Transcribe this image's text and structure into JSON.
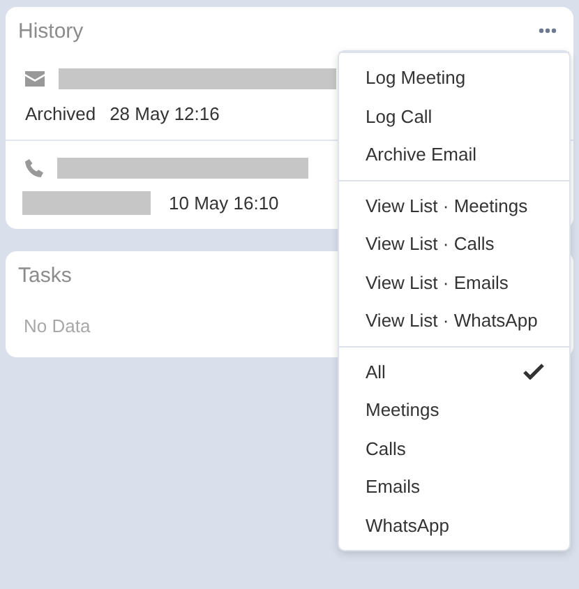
{
  "history": {
    "title": "History",
    "items": [
      {
        "kind": "email",
        "status_hidden": false,
        "status": "Archived",
        "date": "28 May 12:16"
      },
      {
        "kind": "call",
        "status_hidden": true,
        "date": "10 May 16:10"
      }
    ]
  },
  "tasks": {
    "title": "Tasks",
    "empty_text": "No Data"
  },
  "menu": {
    "groups": [
      {
        "items": [
          {
            "label": "Log Meeting"
          },
          {
            "label": "Log Call"
          },
          {
            "label": "Archive Email"
          }
        ]
      },
      {
        "items": [
          {
            "label": "View List · Meetings"
          },
          {
            "label": "View List · Calls"
          },
          {
            "label": "View List · Emails"
          },
          {
            "label": "View List · WhatsApp"
          }
        ]
      },
      {
        "items": [
          {
            "label": "All",
            "selected": true
          },
          {
            "label": "Meetings",
            "selected": false
          },
          {
            "label": "Calls",
            "selected": false
          },
          {
            "label": "Emails",
            "selected": false
          },
          {
            "label": "WhatsApp",
            "selected": false
          }
        ]
      }
    ]
  }
}
